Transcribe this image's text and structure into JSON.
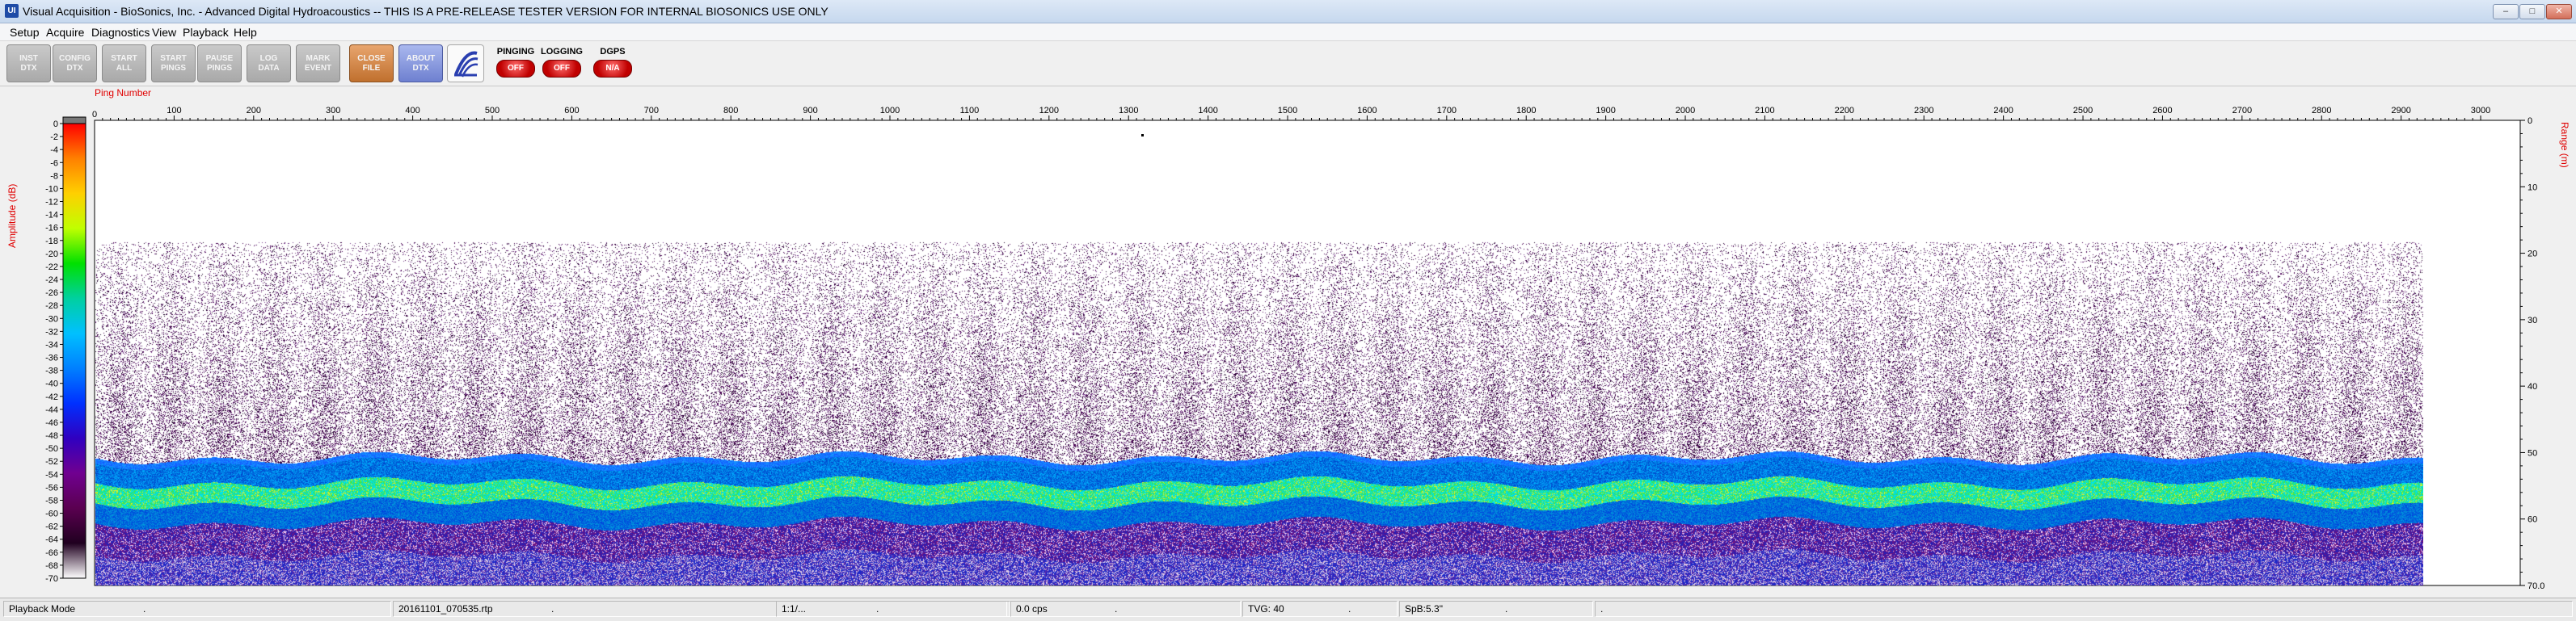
{
  "window": {
    "app_icon": "UI",
    "title": "Visual Acquisition  -  BioSonics, Inc.  -  Advanced Digital Hydroacoustics  -- THIS IS A PRE-RELEASE TESTER VERSION FOR INTERNAL BIOSONICS USE ONLY",
    "controls": {
      "minimize": "–",
      "maximize": "□",
      "close": "✕"
    }
  },
  "menu": [
    "Setup",
    "Acquire",
    "Diagnostics",
    "View",
    "Playback",
    "Help"
  ],
  "toolbar": {
    "buttons": [
      {
        "label": "INST\nDTX",
        "style": "gray"
      },
      {
        "label": "CONFIG\nDTX",
        "style": "gray"
      },
      {
        "label": "START\nALL",
        "style": "gray"
      },
      {
        "label": "START\nPINGS",
        "style": "gray"
      },
      {
        "label": "PAUSE\nPINGS",
        "style": "gray"
      },
      {
        "label": "LOG\nDATA",
        "style": "gray"
      },
      {
        "label": "MARK\nEVENT",
        "style": "gray"
      },
      {
        "label": "CLOSE\nFILE",
        "style": "orange"
      },
      {
        "label": "ABOUT\nDTX",
        "style": "blue"
      }
    ],
    "logo_icon": "biosonics-logo-icon",
    "indicators": [
      {
        "label": "PINGING",
        "state": "OFF"
      },
      {
        "label": "LOGGING",
        "state": "OFF"
      },
      {
        "label": "DGPS",
        "state": "N/A"
      }
    ]
  },
  "plot": {
    "x_axis_label": "Ping Number",
    "x_ticks": [
      "100",
      "200",
      "300",
      "400",
      "500",
      "600",
      "700",
      "800",
      "900",
      "1000",
      "1100",
      "1200",
      "1300",
      "1400",
      "1500",
      "1600",
      "1700",
      "1800",
      "1900",
      "2000",
      "2100",
      "2200",
      "2300",
      "2400",
      "2500",
      "2600",
      "2700",
      "2800",
      "2900",
      "3000"
    ],
    "x_start_label": "0",
    "range_axis_label": "Range (m)",
    "range_ticks": [
      "0",
      "10",
      "20",
      "30",
      "40",
      "50",
      "60",
      "70.0"
    ],
    "amplitude_axis_label": "Amplitude (dB)",
    "amplitude_ticks": [
      "0",
      "-2",
      "-4",
      "-6",
      "-8",
      "-10",
      "-12",
      "-14",
      "-16",
      "-18",
      "-20",
      "-22",
      "-24",
      "-26",
      "-28",
      "-30",
      "-32",
      "-34",
      "-36",
      "-38",
      "-40",
      "-42",
      "-44",
      "-46",
      "-48",
      "-50",
      "-52",
      "-54",
      "-56",
      "-58",
      "-60",
      "-62",
      "-64",
      "-66",
      "-68",
      "-70"
    ],
    "colorscale": [
      "#ff0000",
      "#ff8000",
      "#ffd000",
      "#c0ff00",
      "#00e000",
      "#00d0a0",
      "#00c0ff",
      "#0080ff",
      "#0030ff",
      "#3000c0",
      "#700090",
      "#5a0050",
      "#200020",
      "#ffffff"
    ]
  },
  "statusbar": {
    "mode": "Playback Mode",
    "file": "20161101_070535.rtp",
    "ratio": "1:1/...",
    "cps": "0.0 cps",
    "tvg": "TVG: 40",
    "spb": "SpB:5.3\"",
    "dots": [
      ".",
      ".",
      ".",
      ".",
      ".",
      ".",
      "."
    ]
  }
}
